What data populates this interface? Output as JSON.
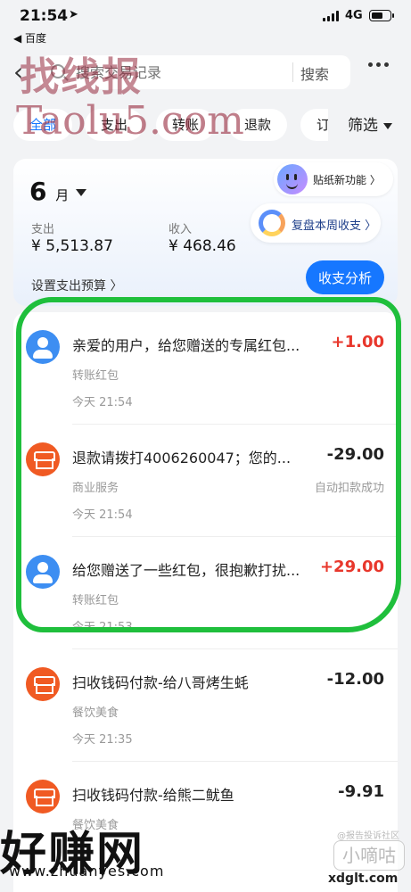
{
  "status_bar": {
    "time": "21:54",
    "network": "4G",
    "back_app": "◀ 百度",
    "battery_level": 0.65
  },
  "nav": {
    "search_placeholder": "搜索交易记录",
    "search_button": "搜索"
  },
  "watermarks": {
    "top_chinese": "找线报",
    "top_latin": "Taolu5.com",
    "bottom_chinese": "好赚网",
    "bottom_url": "www.zhuanyes.com",
    "right_tag": "@报告投诉社区",
    "right_box": "小嘀咕",
    "right_url": "xdglt.com"
  },
  "tabs": [
    {
      "label": "全部"
    },
    {
      "label": "支出"
    },
    {
      "label": "转账"
    },
    {
      "label": "退款"
    },
    {
      "label": "订单"
    }
  ],
  "filter_label": "筛选",
  "summary": {
    "month_number": "6",
    "month_unit": "月",
    "expense_label": "支出",
    "expense_amount": "¥ 5,513.87",
    "income_label": "收入",
    "income_amount": "¥ 468.46",
    "budget_label": "设置支出预算 〉",
    "sticker_text": "贴纸新功能 〉",
    "review_text": "复盘本周收支 〉",
    "analysis_button": "收支分析"
  },
  "transactions": [
    {
      "title": "亲爱的用户，给您赠送的专属红包...",
      "amount": "+1.00",
      "category": "转账红包",
      "status": "",
      "time": "今天 21:54",
      "icon": "user-icon"
    },
    {
      "title": "退款请拨打4006260047；您的...",
      "amount": "-29.00",
      "category": "商业服务",
      "status": "自动扣款成功",
      "time": "今天 21:54",
      "icon": "shop-icon"
    },
    {
      "title": "给您赠送了一些红包，很抱歉打扰...",
      "amount": "+29.00",
      "category": "转账红包",
      "status": "",
      "time": "今天 21:53",
      "icon": "user-icon"
    },
    {
      "title": "扫收钱码付款-给八哥烤生蚝",
      "amount": "-12.00",
      "category": "餐饮美食",
      "status": "",
      "time": "今天 21:35",
      "icon": "shop-icon"
    },
    {
      "title": "扫收钱码付款-给熊二鱿鱼",
      "amount": "-9.91",
      "category": "餐饮美食",
      "status": "",
      "time": "",
      "icon": "shop-icon"
    }
  ],
  "colors": {
    "accent": "#1677ff",
    "positive_amount": "#e8372c",
    "highlight_circle": "#1fbf3c"
  }
}
